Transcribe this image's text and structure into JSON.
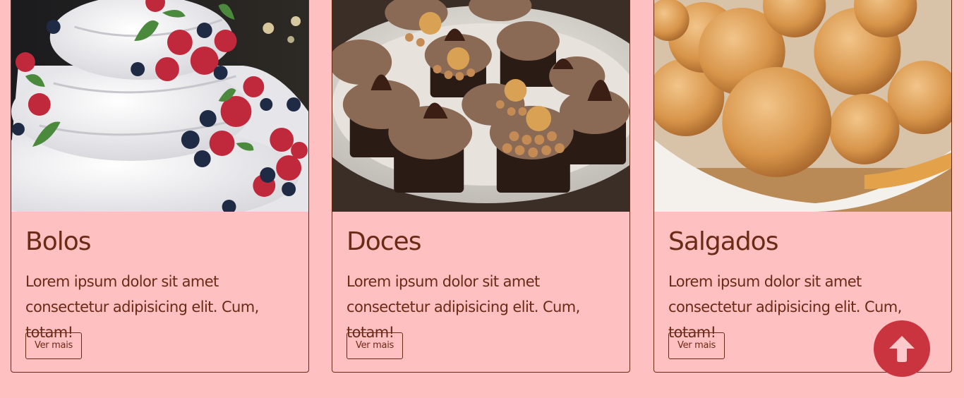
{
  "cards": [
    {
      "title": "Bolos",
      "text": "Lorem ipsum dolor sit amet consectetur adipisicing elit. Cum, totam!",
      "button_label": "Ver mais",
      "image": "cake-photo"
    },
    {
      "title": "Doces",
      "text": "Lorem ipsum dolor sit amet consectetur adipisicing elit. Cum, totam!",
      "button_label": "Ver mais",
      "image": "cupcakes-photo"
    },
    {
      "title": "Salgados",
      "text": "Lorem ipsum dolor sit amet consectetur adipisicing elit. Cum, totam!",
      "button_label": "Ver mais",
      "image": "fried-snacks-photo"
    }
  ],
  "scroll_top_button": {
    "icon": "arrow-up-icon"
  },
  "colors": {
    "background": "#ffc0c2",
    "text": "#6b2a16",
    "accent": "#c9343f"
  }
}
